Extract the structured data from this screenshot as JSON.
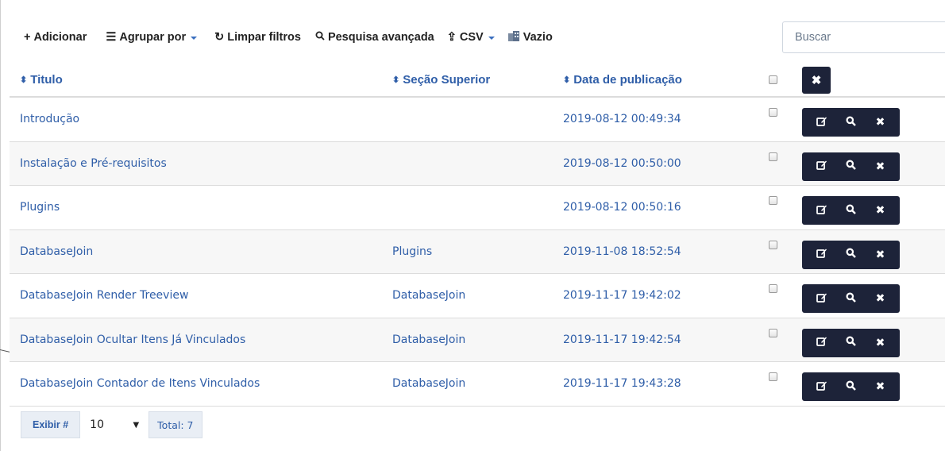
{
  "toolbar": {
    "add_label": "Adicionar",
    "group_label": "Agrupar por",
    "clear_label": "Limpar filtros",
    "advanced_label": "Pesquisa avançada",
    "csv_label": "CSV",
    "empty_label": "Vazio"
  },
  "search": {
    "placeholder": "Buscar"
  },
  "table": {
    "headers": {
      "title": "Titulo",
      "parent": "Seção Superior",
      "date": "Data de publicação"
    },
    "rows": [
      {
        "title": "Introdução",
        "parent": "",
        "date": "2019-08-12 00:49:34"
      },
      {
        "title": "Instalação e Pré-requisitos",
        "parent": "",
        "date": "2019-08-12 00:50:00"
      },
      {
        "title": "Plugins",
        "parent": "",
        "date": "2019-08-12 00:50:16"
      },
      {
        "title": "DatabaseJoin",
        "parent": "Plugins",
        "date": "2019-11-08 18:52:54"
      },
      {
        "title": "DatabaseJoin Render Treeview",
        "parent": "DatabaseJoin",
        "date": "2019-11-17 19:42:02"
      },
      {
        "title": "DatabaseJoin Ocultar Itens Já Vinculados",
        "parent": "DatabaseJoin",
        "date": "2019-11-17 19:42:54"
      },
      {
        "title": "DatabaseJoin Contador de Itens Vinculados",
        "parent": "DatabaseJoin",
        "date": "2019-11-17 19:43:28"
      }
    ]
  },
  "footer": {
    "show_label": "Exibir #",
    "page_size": "10",
    "total_label": "Total: 7"
  },
  "icons": {
    "add": "plus-icon",
    "group": "list-icon",
    "clear": "refresh-icon",
    "advanced": "search-icon",
    "csv": "upload-icon",
    "empty": "building-icon",
    "sort": "sort-icon",
    "edit": "edit-icon",
    "view": "search-icon",
    "delete": "close-icon"
  },
  "colors": {
    "link": "#2f5ea8",
    "action_bg": "#1d2339",
    "stripe": "#f7f7f7"
  }
}
